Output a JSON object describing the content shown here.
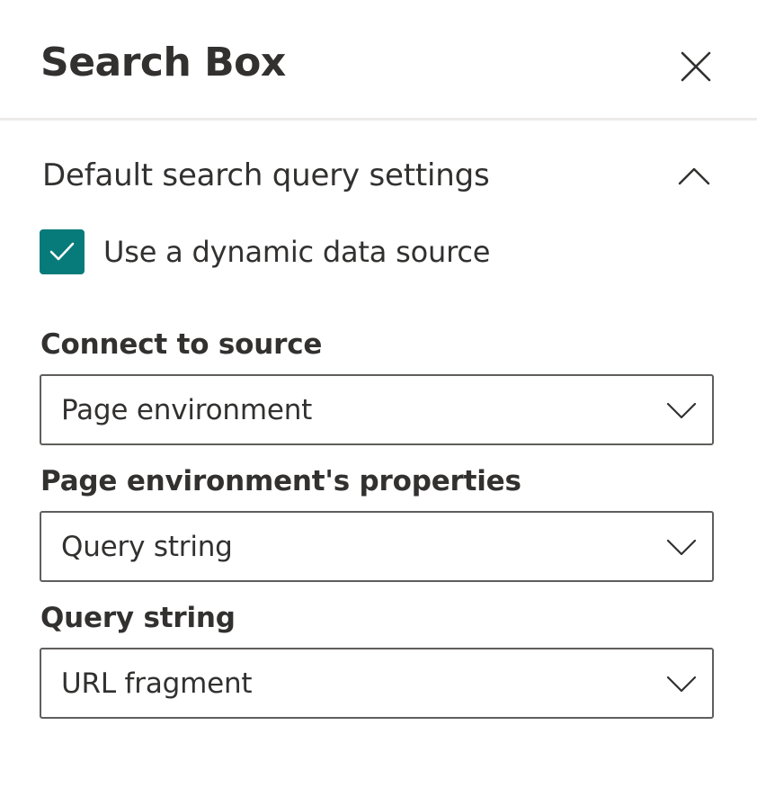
{
  "panel": {
    "title": "Search Box",
    "close_icon": "close-icon"
  },
  "section": {
    "title": "Default search query settings",
    "expanded": true,
    "chevron_icon": "chevron-up-icon"
  },
  "dynamic_source": {
    "label": "Use a dynamic data source",
    "checked": true,
    "check_color": "#077a7a"
  },
  "fields": [
    {
      "label": "Connect to source",
      "value": "Page environment"
    },
    {
      "label": "Page environment's properties",
      "value": "Query string"
    },
    {
      "label": "Query string",
      "value": "URL fragment"
    }
  ]
}
